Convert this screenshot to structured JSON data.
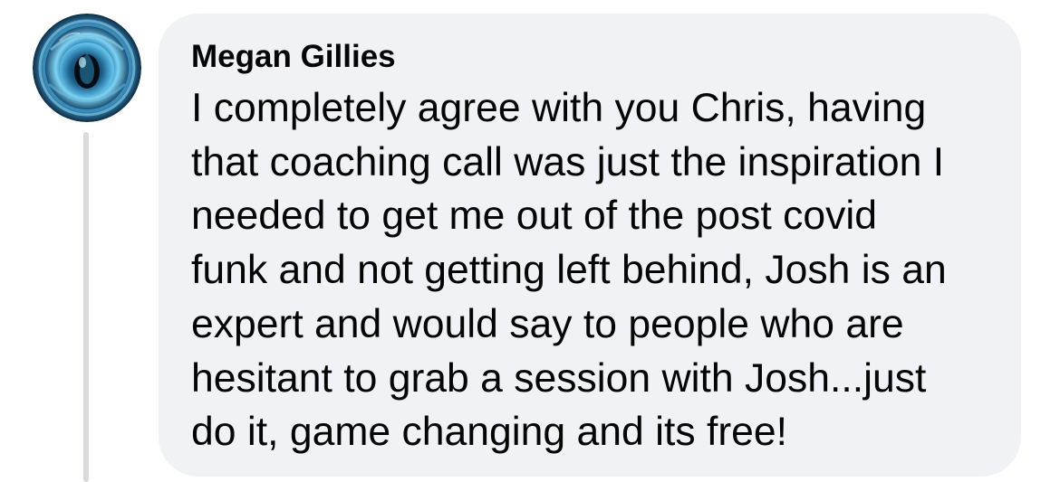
{
  "comment": {
    "author": "Megan Gillies",
    "avatar_icon": "blue-eye-avatar",
    "text_lines": [
      "I completely agree with you Chris, having",
      "that coaching call was just the inspiration I",
      "needed to get me out of the post covid",
      "funk and not getting left behind, Josh is an",
      "expert and would say to people who are",
      "hesitant to grab a session with Josh...just",
      "do it, game changing and its free!"
    ]
  },
  "colors": {
    "bubble_bg": "#f0f2f5",
    "text": "#050505",
    "thread_line": "#d9dadd"
  }
}
